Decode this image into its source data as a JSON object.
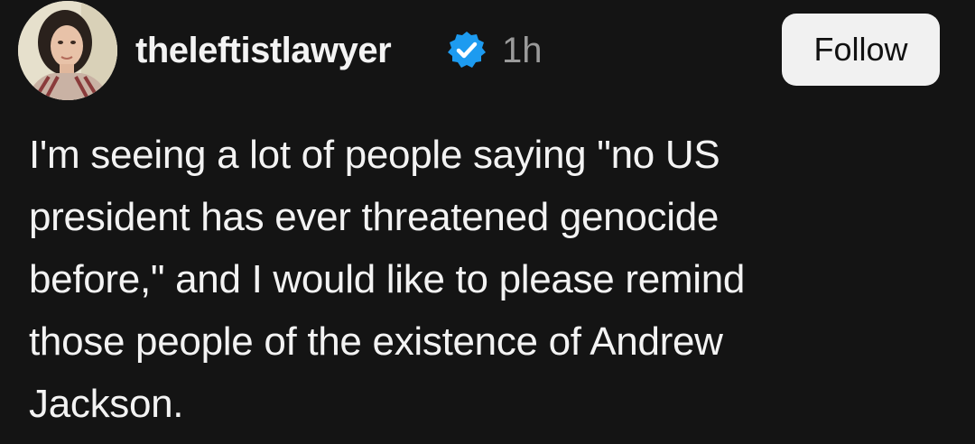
{
  "post": {
    "author": {
      "username": "theleftistlawyer",
      "verified": true,
      "avatar_icon": "profile-photo"
    },
    "timestamp": "1h",
    "follow_label": "Follow",
    "body_lines": [
      "I'm seeing a lot of people saying \"no US",
      "president has ever threatened genocide",
      "before,\" and I would like to please remind",
      "those people of the existence of Andrew",
      "Jackson."
    ]
  },
  "colors": {
    "background": "#141414",
    "text": "#f3f3f3",
    "muted": "#9a9a9a",
    "verified_blue": "#1d9bf0",
    "button_bg": "#f1f1f1"
  }
}
